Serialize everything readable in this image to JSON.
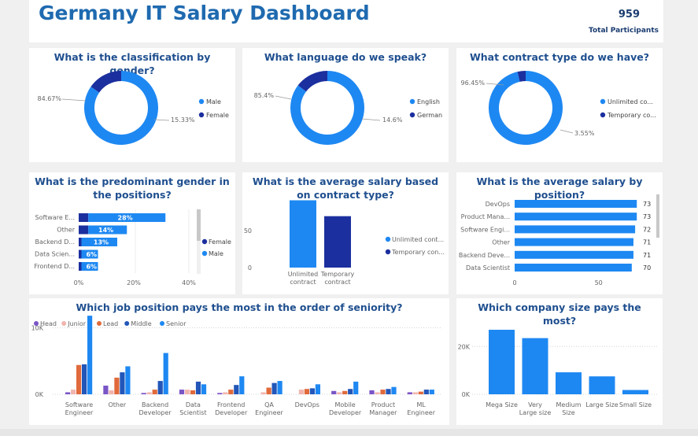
{
  "header": {
    "title": "Germany IT Salary Dashboard",
    "participants_value": "959",
    "participants_label": "Total Participants"
  },
  "colors": {
    "primary": "#1e88f2",
    "dark": "#1c2f9e",
    "head": "#7a55c7",
    "junior": "#f1b5ae",
    "lead": "#e06a3b",
    "middle": "#2256b8",
    "senior": "#1e88f2"
  },
  "chart_data": [
    {
      "id": "gender",
      "type": "pie",
      "title": "What is the classification by gender?",
      "categories": [
        "Male",
        "Female"
      ],
      "values": [
        84.67,
        15.33
      ],
      "value_labels": [
        "84.67%",
        "15.33%"
      ],
      "colors": [
        "#1e88f2",
        "#1c2f9e"
      ],
      "legend_placement": "right"
    },
    {
      "id": "language",
      "type": "pie",
      "title": "What language do we speak?",
      "categories": [
        "English",
        "German"
      ],
      "values": [
        85.4,
        14.6
      ],
      "value_labels": [
        "85.4%",
        "14.6%"
      ],
      "colors": [
        "#1e88f2",
        "#1c2f9e"
      ],
      "legend_placement": "right"
    },
    {
      "id": "contract",
      "type": "pie",
      "title": "What contract type do we have?",
      "categories": [
        "Unlimited co...",
        "Temporary co..."
      ],
      "values": [
        96.45,
        3.55
      ],
      "value_labels": [
        "96.45%",
        "3.55%"
      ],
      "colors": [
        "#1e88f2",
        "#1c2f9e"
      ],
      "legend_placement": "right"
    },
    {
      "id": "gender_position",
      "type": "bar",
      "orientation": "horizontal",
      "stacked": true,
      "title": "What is the predominant gender in the positions?",
      "categories": [
        "Software E...",
        "Other",
        "Backend D...",
        "Data Scien...",
        "Frontend D..."
      ],
      "series": [
        {
          "name": "Female",
          "values": [
            3.5,
            3.5,
            1,
            1,
            1
          ],
          "color": "#1c2f9e"
        },
        {
          "name": "Male",
          "values": [
            28,
            14,
            13,
            6,
            6
          ],
          "color": "#1e88f2"
        }
      ],
      "data_labels": [
        "28%",
        "14%",
        "13%",
        "6%",
        "6%"
      ],
      "xlim": [
        0,
        40
      ],
      "xticks": [
        "0%",
        "20%",
        "40%"
      ],
      "legend_placement": "right"
    },
    {
      "id": "salary_contract",
      "type": "bar",
      "title": "What is the average salary based on contract type?",
      "categories": [
        "Unlimited contract",
        "Temporary contract"
      ],
      "category_lines": [
        [
          "Unlimited",
          "contract"
        ],
        [
          "Temporary",
          "contract"
        ]
      ],
      "values": [
        72,
        55
      ],
      "colors": [
        "#1e88f2",
        "#1c2f9e"
      ],
      "ylim": [
        0,
        80
      ],
      "yticks": [
        "0",
        "50"
      ],
      "legend": [
        "Unlimited cont...",
        "Temporary con..."
      ],
      "legend_placement": "right"
    },
    {
      "id": "salary_position",
      "type": "bar",
      "orientation": "horizontal",
      "title": "What is the average salary by position?",
      "categories": [
        "DevOps",
        "Product Mana...",
        "Software Engi...",
        "Other",
        "Backend Deve...",
        "Data Scientist"
      ],
      "values": [
        73,
        73,
        72,
        71,
        71,
        70
      ],
      "xlim": [
        0,
        75
      ],
      "xticks": [
        "0",
        "50"
      ]
    },
    {
      "id": "seniority",
      "type": "bar",
      "title": "Which job position pays the most in the order of seniority?",
      "categories": [
        "Software Engineer",
        "Other",
        "Backend Developer",
        "Data Scientist",
        "Frontend Developer",
        "QA Engineer",
        "DevOps",
        "Mobile Developer",
        "Product Manager",
        "ML Engineer"
      ],
      "category_lines": [
        [
          "Software",
          "Engineer"
        ],
        [
          "Other"
        ],
        [
          "Backend",
          "Developer"
        ],
        [
          "Data",
          "Scientist"
        ],
        [
          "Frontend",
          "Developer"
        ],
        [
          "QA",
          "Engineer"
        ],
        [
          "DevOps"
        ],
        [
          "Mobile",
          "Developer"
        ],
        [
          "Product",
          "Manager"
        ],
        [
          "ML",
          "Engineer"
        ]
      ],
      "series": [
        {
          "name": "Head",
          "values": [
            300,
            1300,
            200,
            700,
            200,
            0,
            0,
            500,
            600,
            300
          ]
        },
        {
          "name": "Junior",
          "values": [
            700,
            600,
            300,
            700,
            300,
            300,
            700,
            300,
            300,
            300
          ]
        },
        {
          "name": "Lead",
          "values": [
            4400,
            2500,
            700,
            600,
            700,
            1000,
            800,
            500,
            700,
            400
          ]
        },
        {
          "name": "Middle",
          "values": [
            4500,
            3300,
            2000,
            1900,
            1400,
            1700,
            900,
            800,
            800,
            700
          ]
        },
        {
          "name": "Senior",
          "values": [
            11800,
            4200,
            6200,
            1500,
            2700,
            2000,
            1500,
            1900,
            1100,
            700
          ]
        }
      ],
      "ylim": [
        0,
        13000
      ],
      "yticks": [
        "0K",
        "10K"
      ],
      "legend_placement": "top-left"
    },
    {
      "id": "company_size",
      "type": "bar",
      "title": "Which company size pays the most?",
      "categories": [
        "Mega Size",
        "Very Large size",
        "Medium Size",
        "Large Size",
        "Small Size"
      ],
      "category_lines": [
        [
          "Mega Size"
        ],
        [
          "Very",
          "Large size"
        ],
        [
          "Medium",
          "Size"
        ],
        [
          "Large Size"
        ],
        [
          "Small Size"
        ]
      ],
      "values": [
        27000,
        23500,
        9200,
        7500,
        1800
      ],
      "ylim": [
        0,
        30000
      ],
      "yticks": [
        "0K",
        "20K"
      ]
    }
  ]
}
